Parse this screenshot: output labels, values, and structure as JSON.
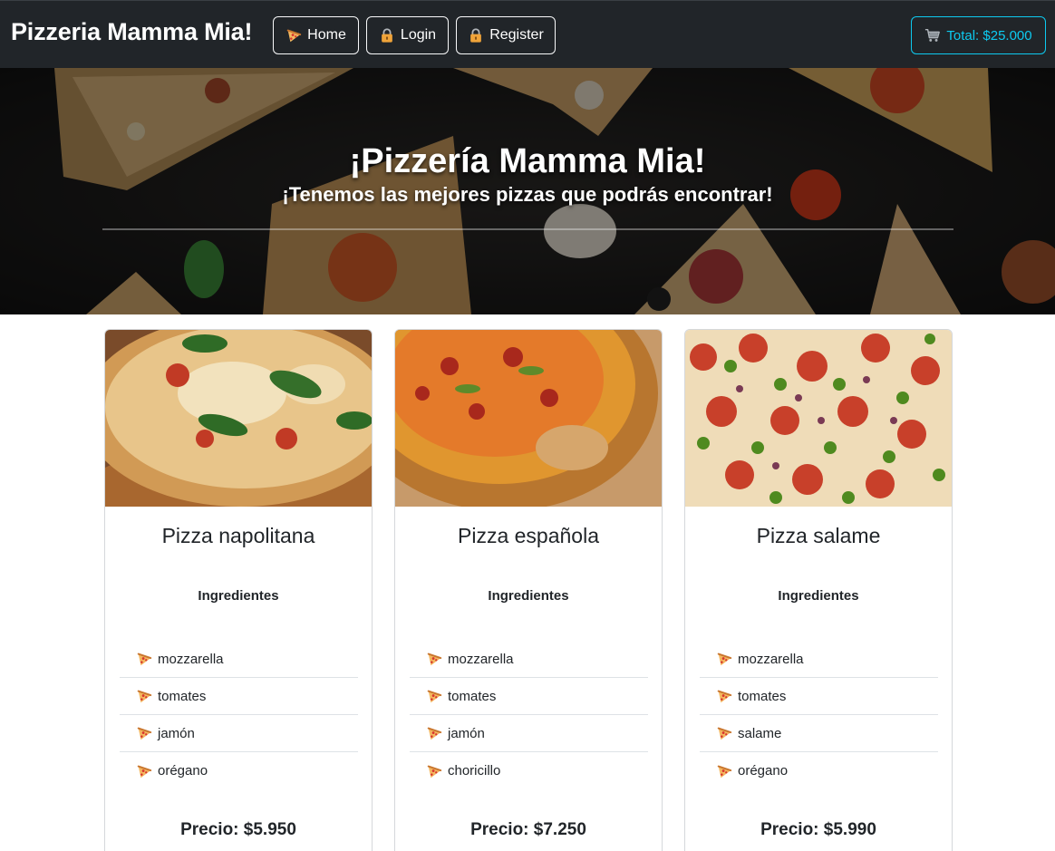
{
  "navbar": {
    "brand": "Pizzeria Mamma Mia!",
    "buttons": [
      {
        "label": "Home",
        "icon": "pizza-icon"
      },
      {
        "label": "Login",
        "icon": "lock-icon"
      },
      {
        "label": "Register",
        "icon": "lock-icon"
      }
    ],
    "cart": {
      "label": "Total: $25.000",
      "icon": "cart-icon"
    }
  },
  "hero": {
    "title": "¡Pizzería Mamma Mia!",
    "subtitle": "¡Tenemos las mejores pizzas que podrás encontrar!"
  },
  "ingredients_heading": "Ingredientes",
  "pizzas": [
    {
      "name": "Pizza napolitana",
      "ingredients": [
        "mozzarella",
        "tomates",
        "jamón",
        "orégano"
      ],
      "price": "Precio: $5.950"
    },
    {
      "name": "Pizza española",
      "ingredients": [
        "mozzarella",
        "tomates",
        "jamón",
        "choricillo"
      ],
      "price": "Precio: $7.250"
    },
    {
      "name": "Pizza salame",
      "ingredients": [
        "mozzarella",
        "tomates",
        "salame",
        "orégano"
      ],
      "price": "Precio: $5.990"
    }
  ],
  "colors": {
    "navbar_bg": "#212529",
    "cart_accent": "#0dcaf0",
    "card_border": "#d5d8db"
  }
}
